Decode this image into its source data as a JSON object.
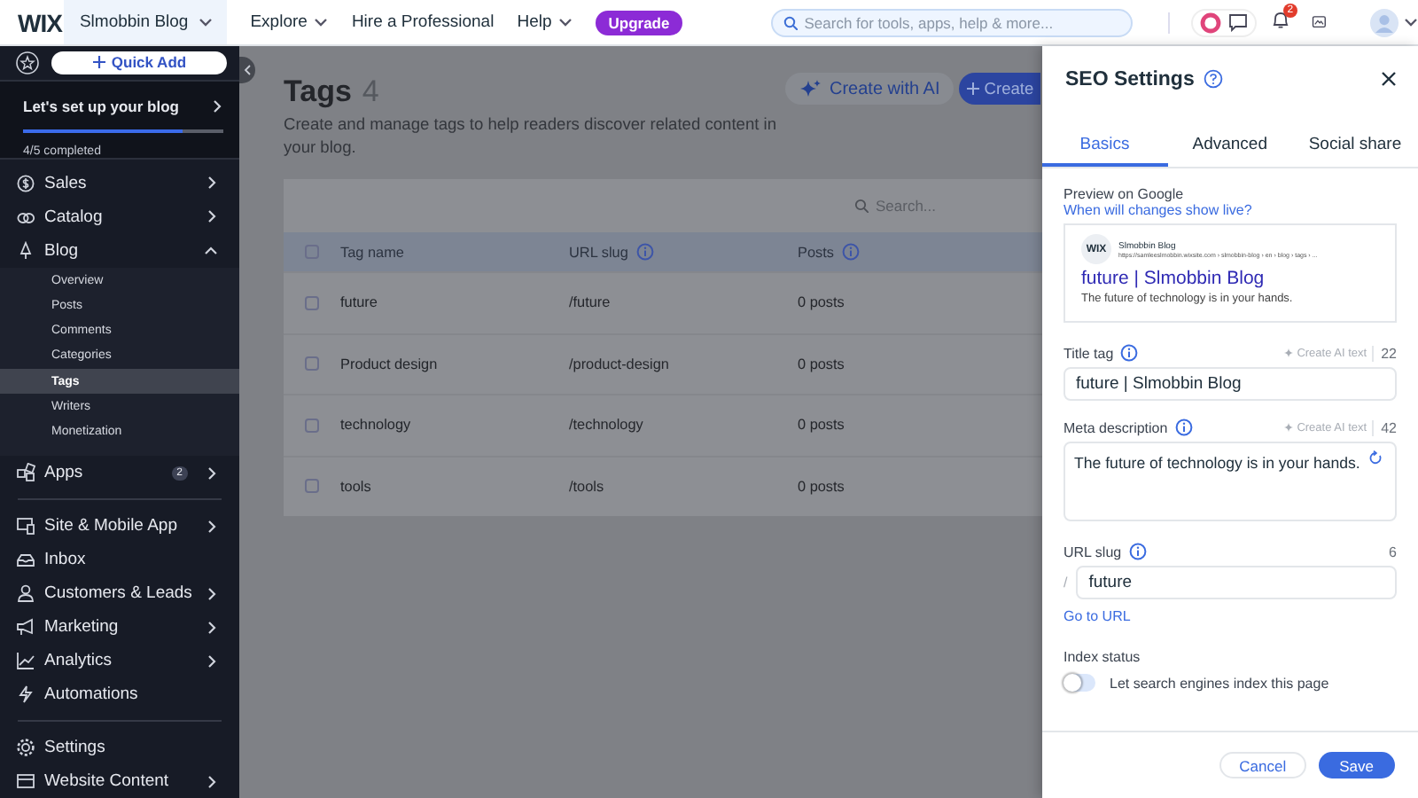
{
  "topbar": {
    "logo": "WIX",
    "site_name": "Slmobbin Blog",
    "menu": [
      {
        "label": "Explore",
        "dropdown": true
      },
      {
        "label": "Hire a Professional",
        "dropdown": false
      },
      {
        "label": "Help",
        "dropdown": true
      }
    ],
    "upgrade": "Upgrade",
    "search": {
      "placeholder": "Search for tools, apps, help & more..."
    },
    "notifications_badge": "2"
  },
  "sidebar": {
    "quick_add": "Quick Add",
    "setup": {
      "title": "Let's set up your blog",
      "level": 0.8,
      "progress": "4/5 completed"
    },
    "nav": [
      {
        "kind": "item",
        "label": "Sales",
        "expanded": false
      },
      {
        "kind": "item",
        "label": "Catalog",
        "expanded": false
      },
      {
        "kind": "item",
        "label": "Blog",
        "expanded": true,
        "children": [
          {
            "label": "Overview",
            "selected": false
          },
          {
            "label": "Posts",
            "selected": false
          },
          {
            "label": "Comments",
            "selected": false
          },
          {
            "label": "Categories",
            "selected": false
          },
          {
            "label": "Tags",
            "selected": true
          },
          {
            "label": "Writers",
            "selected": false
          },
          {
            "label": "Monetization",
            "selected": false
          }
        ]
      },
      {
        "kind": "item",
        "label": "Apps",
        "badge": "2",
        "expanded": false
      },
      {
        "kind": "divider"
      },
      {
        "kind": "item",
        "label": "Site & Mobile App",
        "expanded": false
      },
      {
        "kind": "item",
        "label": "Inbox"
      },
      {
        "kind": "item",
        "label": "Customers & Leads",
        "expanded": false
      },
      {
        "kind": "item",
        "label": "Marketing",
        "expanded": false
      },
      {
        "kind": "item",
        "label": "Analytics",
        "expanded": false
      },
      {
        "kind": "item",
        "label": "Automations"
      },
      {
        "kind": "divider"
      },
      {
        "kind": "item",
        "label": "Settings"
      },
      {
        "kind": "item",
        "label": "Website Content",
        "expanded": false
      }
    ]
  },
  "page": {
    "title": "Tags",
    "count": "4",
    "description": "Create and manage tags to help readers discover related content in your blog.",
    "buttons": [
      {
        "kind": "ai",
        "label": "Create with AI"
      },
      {
        "kind": "primary",
        "label": "Create"
      }
    ],
    "table": {
      "search": {
        "placeholder": "Search..."
      },
      "all_checked": false,
      "columns": [
        {
          "label": "Tag name",
          "info": false
        },
        {
          "label": "URL slug",
          "info": true
        },
        {
          "label": "Posts",
          "info": true
        }
      ],
      "rows": [
        {
          "checked": false,
          "cells": [
            "future",
            "/future",
            "0 posts"
          ]
        },
        {
          "checked": false,
          "cells": [
            "Product design",
            "/product-design",
            "0 posts"
          ]
        },
        {
          "checked": false,
          "cells": [
            "technology",
            "/technology",
            "0 posts"
          ]
        },
        {
          "checked": false,
          "cells": [
            "tools",
            "/tools",
            "0 posts"
          ]
        }
      ]
    }
  },
  "seo_panel": {
    "title": "SEO Settings",
    "tabs": [
      {
        "label": "Basics",
        "selected": true
      },
      {
        "label": "Advanced",
        "selected": false
      },
      {
        "label": "Social share",
        "selected": false
      }
    ],
    "preview": {
      "label": "Preview on Google",
      "link": "When will changes show live?",
      "favicon": "WIX",
      "site": "Slmobbin Blog",
      "url": "https://samleeslmobbin.wixsite.com › slmobbin-blog › en › blog › tags › ...",
      "title": "future | Slmobbin Blog",
      "description": "The future of technology is in your hands."
    },
    "title_tag": {
      "label": "Title tag",
      "ai": "Create AI text",
      "count": "22",
      "value": "future | Slmobbin Blog"
    },
    "meta_description": {
      "label": "Meta description",
      "ai": "Create AI text",
      "count": "42",
      "value": "The future of technology is in your hands."
    },
    "url_slug": {
      "label": "URL slug",
      "prefix": "/",
      "count": "6",
      "value": "future",
      "link": "Go to URL"
    },
    "index_status": {
      "label": "Index status",
      "toggle_label": "Let search engines index this page",
      "on": false
    },
    "buttons": {
      "cancel": "Cancel",
      "save": "Save"
    }
  }
}
